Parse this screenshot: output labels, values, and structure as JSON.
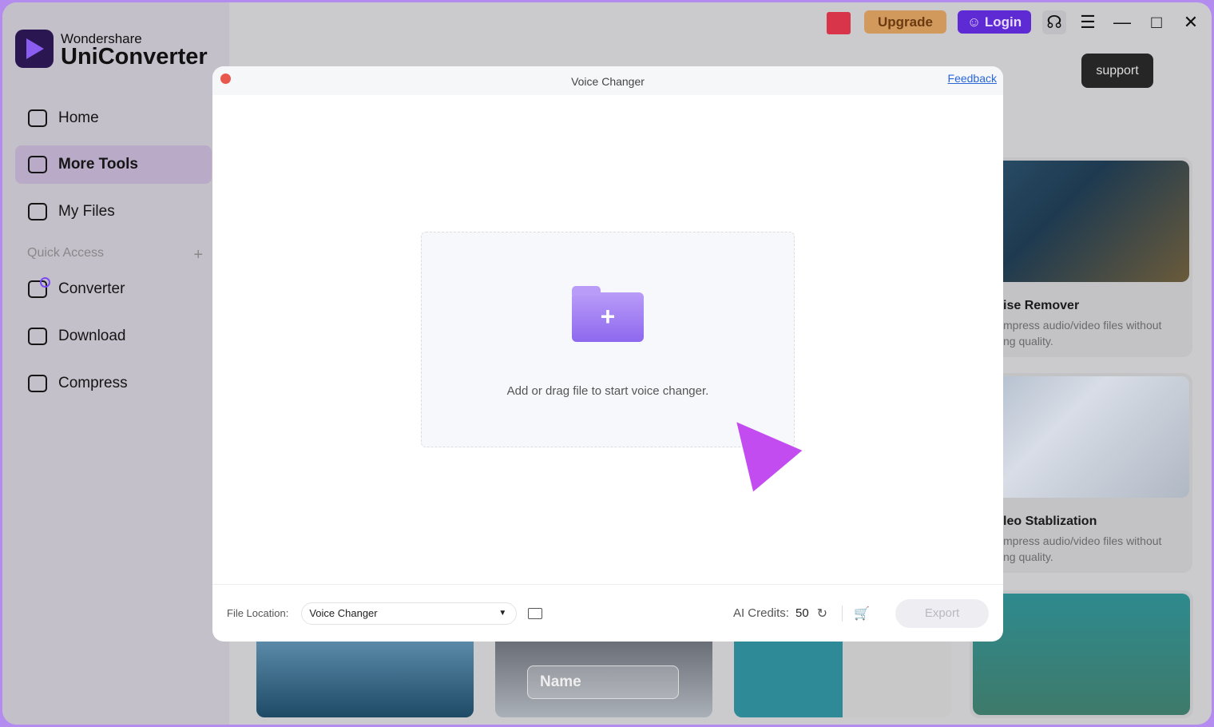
{
  "app": {
    "brand_small": "Wondershare",
    "brand_large": "UniConverter"
  },
  "sidebar": {
    "items": [
      {
        "label": "Home",
        "icon": "home-icon"
      },
      {
        "label": "More Tools",
        "icon": "toolbox-icon",
        "active": true
      },
      {
        "label": "My Files",
        "icon": "files-icon"
      }
    ],
    "quick_access_label": "Quick Access",
    "quick_items": [
      {
        "label": "Converter",
        "icon": "converter-icon"
      },
      {
        "label": "Download",
        "icon": "download-icon"
      },
      {
        "label": "Compress",
        "icon": "compress-icon"
      }
    ]
  },
  "topbar": {
    "upgrade": "Upgrade",
    "login": "Login",
    "tooltip": "support"
  },
  "cards": [
    {
      "title": "ise Remover",
      "desc1": "mpress audio/video files without",
      "desc2": "ng quality."
    },
    {
      "title": "leo Stablization",
      "desc1": "mpress audio/video files without",
      "desc2": "ng quality."
    }
  ],
  "bottom_cards": {
    "name_label": "Name"
  },
  "modal": {
    "title": "Voice Changer",
    "feedback": "Feedback",
    "drop_text": "Add or drag file to start voice changer.",
    "file_location_label": "File Location:",
    "file_location_value": "Voice Changer",
    "credits_label": "AI Credits:",
    "credits_value": "50",
    "export": "Export"
  },
  "colors": {
    "accent": "#5e2ad3",
    "upgrade": "#d19a5c"
  }
}
